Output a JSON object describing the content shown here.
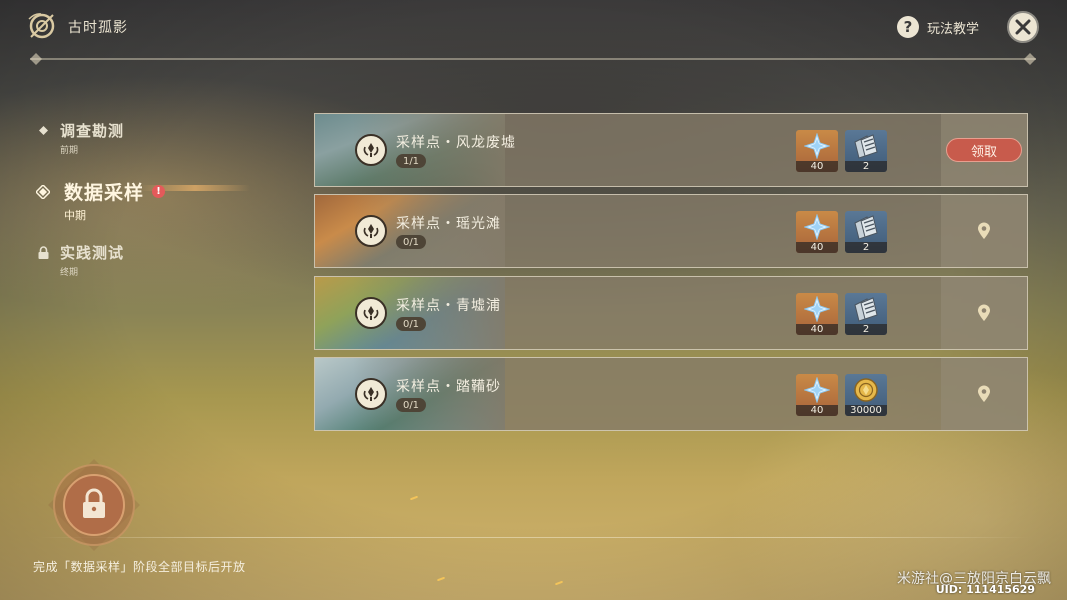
{
  "header": {
    "title": "古时孤影",
    "help_label": "玩法教学",
    "help_icon": "question-icon",
    "close_icon": "close-icon"
  },
  "phases": [
    {
      "name": "调查勘测",
      "sub": "前期",
      "state": "normal",
      "icon": "diamond-icon"
    },
    {
      "name": "数据采样",
      "sub": "中期",
      "state": "active",
      "icon": "diamond-icon",
      "badge": "!"
    },
    {
      "name": "实践测试",
      "sub": "终期",
      "state": "locked",
      "icon": "lock-icon"
    }
  ],
  "tasks": [
    {
      "title": "采样点・风龙废墟",
      "progress": "1/1",
      "rewards": [
        {
          "item": "primogem",
          "count": "40"
        },
        {
          "item": "talent-book",
          "count": "2"
        }
      ],
      "action": {
        "type": "claim",
        "label": "领取"
      }
    },
    {
      "title": "采样点・瑶光滩",
      "progress": "0/1",
      "rewards": [
        {
          "item": "primogem",
          "count": "40"
        },
        {
          "item": "talent-book",
          "count": "2"
        }
      ],
      "action": {
        "type": "pin",
        "icon": "location-pin-icon"
      }
    },
    {
      "title": "采样点・青墟浦",
      "progress": "0/1",
      "rewards": [
        {
          "item": "primogem",
          "count": "40"
        },
        {
          "item": "talent-book",
          "count": "2"
        }
      ],
      "action": {
        "type": "pin",
        "icon": "location-pin-icon"
      }
    },
    {
      "title": "采样点・踏鞴砂",
      "progress": "0/1",
      "rewards": [
        {
          "item": "primogem",
          "count": "40"
        },
        {
          "item": "mora",
          "count": "30000"
        }
      ],
      "action": {
        "type": "pin",
        "icon": "location-pin-icon"
      }
    }
  ],
  "footer": {
    "unlock_hint": "完成「数据采样」阶段全部目标后开放",
    "watermark": "米游社@三放阳京白云飘",
    "uid": "UID: 111415629"
  },
  "colors": {
    "claim_button": "#c85b4c",
    "alert_badge": "#e45a5a",
    "text_primary": "#ece5d3"
  }
}
